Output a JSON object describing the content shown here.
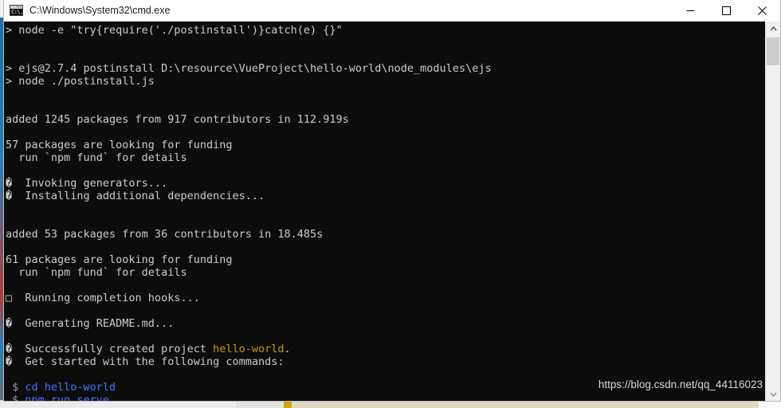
{
  "window": {
    "title": "C:\\Windows\\System32\\cmd.exe",
    "icon_name": "cmd-console-icon",
    "icon_text": "C:\\.",
    "controls": {
      "minimize_label": "Minimize",
      "maximize_label": "Maximize",
      "close_label": "Close"
    }
  },
  "console": {
    "background_color": "#0c0c0c",
    "foreground_color": "#cccccc",
    "accent_yellow": "#c19c00",
    "accent_blue": "#3b78ff",
    "lines": [
      {
        "id": "l01",
        "segments": [
          {
            "text": "> node -e \"try{require('./postinstall')}catch(e) {}\"",
            "color": "white"
          }
        ]
      },
      {
        "id": "l02",
        "segments": [
          {
            "text": "",
            "color": "white"
          }
        ]
      },
      {
        "id": "l03",
        "segments": [
          {
            "text": "",
            "color": "white"
          }
        ]
      },
      {
        "id": "l04",
        "segments": [
          {
            "text": "> ejs@2.7.4 postinstall D:\\resource\\VueProject\\hello-world\\node_modules\\ejs",
            "color": "white"
          }
        ]
      },
      {
        "id": "l05",
        "segments": [
          {
            "text": "> node ./postinstall.js",
            "color": "white"
          }
        ]
      },
      {
        "id": "l06",
        "segments": [
          {
            "text": "",
            "color": "white"
          }
        ]
      },
      {
        "id": "l07",
        "segments": [
          {
            "text": "",
            "color": "white"
          }
        ]
      },
      {
        "id": "l08",
        "segments": [
          {
            "text": "added 1245 packages from 917 contributors in 112.919s",
            "color": "white"
          }
        ]
      },
      {
        "id": "l09",
        "segments": [
          {
            "text": "",
            "color": "white"
          }
        ]
      },
      {
        "id": "l10",
        "segments": [
          {
            "text": "57 packages are looking for funding",
            "color": "white"
          }
        ]
      },
      {
        "id": "l11",
        "segments": [
          {
            "text": "  run `npm fund` for details",
            "color": "white"
          }
        ]
      },
      {
        "id": "l12",
        "segments": [
          {
            "text": "",
            "color": "white"
          }
        ]
      },
      {
        "id": "l13",
        "segments": [
          {
            "text": "�  Invoking generators...",
            "color": "white"
          }
        ]
      },
      {
        "id": "l14",
        "segments": [
          {
            "text": "�  Installing additional dependencies...",
            "color": "white"
          }
        ]
      },
      {
        "id": "l15",
        "segments": [
          {
            "text": "",
            "color": "white"
          }
        ]
      },
      {
        "id": "l16",
        "segments": [
          {
            "text": "",
            "color": "white"
          }
        ]
      },
      {
        "id": "l17",
        "segments": [
          {
            "text": "added 53 packages from 36 contributors in 18.485s",
            "color": "white"
          }
        ]
      },
      {
        "id": "l18",
        "segments": [
          {
            "text": "",
            "color": "white"
          }
        ]
      },
      {
        "id": "l19",
        "segments": [
          {
            "text": "61 packages are looking for funding",
            "color": "white"
          }
        ]
      },
      {
        "id": "l20",
        "segments": [
          {
            "text": "  run `npm fund` for details",
            "color": "white"
          }
        ]
      },
      {
        "id": "l21",
        "segments": [
          {
            "text": "",
            "color": "white"
          }
        ]
      },
      {
        "id": "l22",
        "segments": [
          {
            "text": "□  Running completion hooks...",
            "color": "white"
          }
        ]
      },
      {
        "id": "l23",
        "segments": [
          {
            "text": "",
            "color": "white"
          }
        ]
      },
      {
        "id": "l24",
        "segments": [
          {
            "text": "�  Generating README.md...",
            "color": "white"
          }
        ]
      },
      {
        "id": "l25",
        "segments": [
          {
            "text": "",
            "color": "white"
          }
        ]
      },
      {
        "id": "l26",
        "segments": [
          {
            "text": "�  Successfully created project ",
            "color": "white"
          },
          {
            "text": "hello-world",
            "color": "yellow"
          },
          {
            "text": ".",
            "color": "white"
          }
        ]
      },
      {
        "id": "l27",
        "segments": [
          {
            "text": "�  Get started with the following commands:",
            "color": "white"
          }
        ]
      },
      {
        "id": "l28",
        "segments": [
          {
            "text": "",
            "color": "white"
          }
        ]
      },
      {
        "id": "l29",
        "segments": [
          {
            "text": " $ ",
            "color": "gray"
          },
          {
            "text": "cd hello-world",
            "color": "blue"
          }
        ]
      },
      {
        "id": "l30",
        "segments": [
          {
            "text": " $ ",
            "color": "gray"
          },
          {
            "text": "npm run serve",
            "color": "blue"
          }
        ]
      }
    ]
  },
  "watermark": {
    "text": "https://blog.csdn.net/qq_44116023"
  },
  "scrollbar": {
    "up_arrow_label": "Scroll up",
    "down_arrow_label": "Scroll down",
    "thumb_label": "Scroll thumb"
  }
}
